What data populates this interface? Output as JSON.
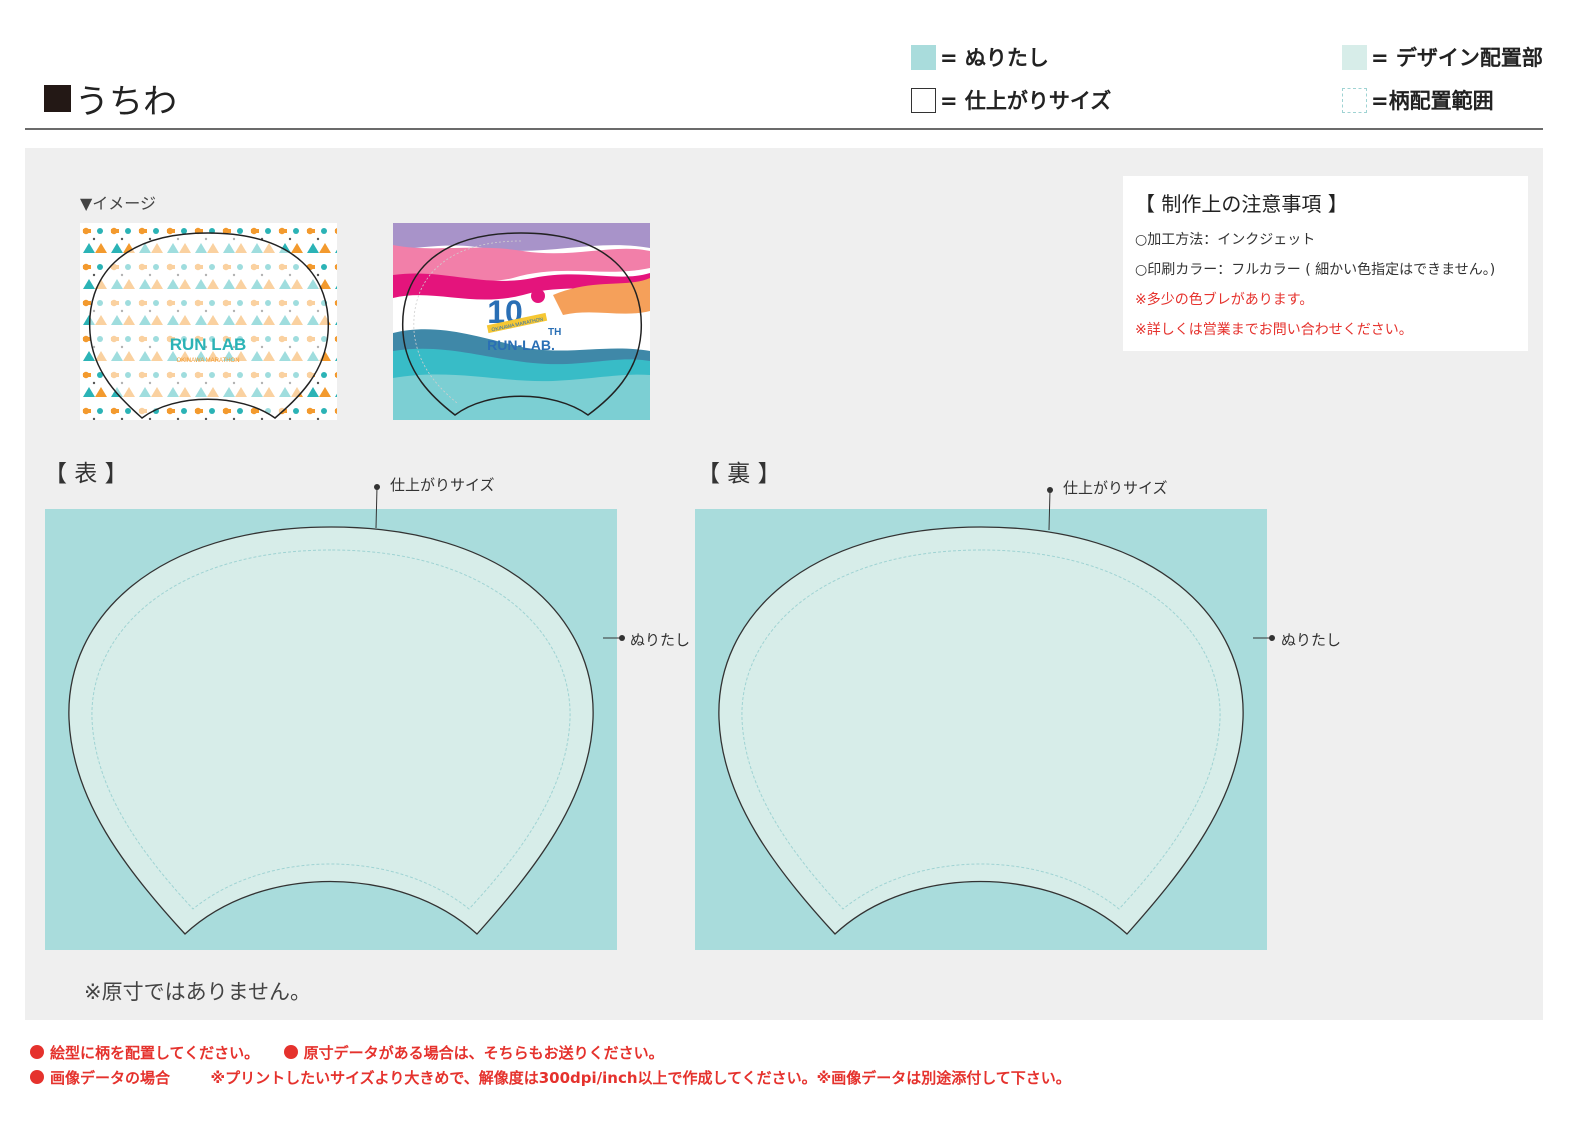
{
  "header": {
    "title": "うちわ"
  },
  "legend": {
    "bleed": "= ぬりたし",
    "trim": "= 仕上がりサイズ",
    "design": "= デザイン配置部",
    "pattern_range": "=柄配置範囲"
  },
  "images": {
    "label": "▼イメージ",
    "thumb1_text": "RUN LAB",
    "thumb1_subtext": "OKINAWA MARATHON",
    "thumb2_number": "10",
    "thumb2_suffix": "TH",
    "thumb2_ribbon": "OKINAWA MARATHON",
    "thumb2_text": "RUN-LAB."
  },
  "notes": {
    "heading": "【 制作上の注意事項 】",
    "lines": [
      "○加工方法：インクジェット",
      "○印刷カラー：フルカラー ( 細かい色指定はできません。)"
    ],
    "red_lines": [
      "※多少の色ブレがあります。",
      "※詳しくは営業までお問い合わせください。"
    ]
  },
  "front": {
    "label": "【 表 】",
    "trim_callout": "仕上がりサイズ",
    "bleed_callout": "ぬりたし"
  },
  "back": {
    "label": "【 裏 】",
    "trim_callout": "仕上がりサイズ",
    "bleed_callout": "ぬりたし"
  },
  "scale_note": "※原寸ではありません。",
  "footer": {
    "line1": [
      "絵型に柄を配置してください。",
      "原寸データがある場合は、そちらもお送りください。"
    ],
    "line2_label": "画像データの場合",
    "line2_text": "※プリントしたいサイズより大きめで、解像度は300dpi/inch以上で作成してください。※画像データは別途添付して下さい。"
  },
  "colors": {
    "bleed": "#a9dcdc",
    "design": "#d7ede9",
    "pattern_range_line": "#9fd3d3",
    "accent_red": "#e5322d"
  }
}
